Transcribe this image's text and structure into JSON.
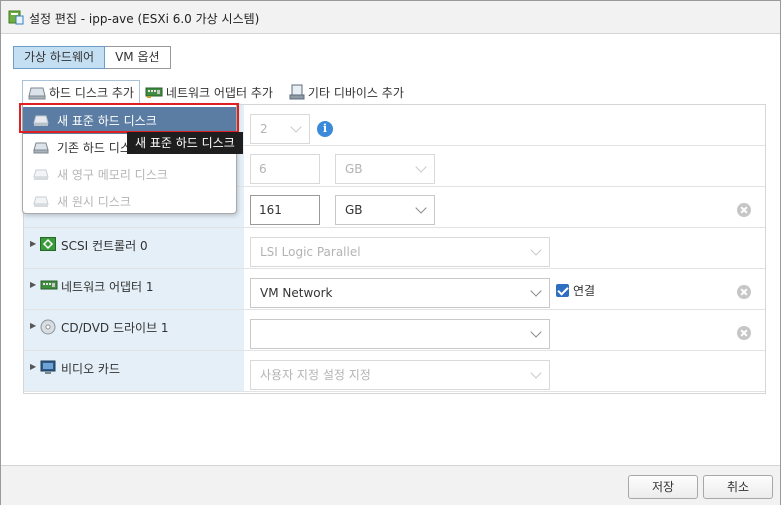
{
  "window": {
    "title": "설정 편집 - ipp-ave (ESXi 6.0 가상 시스템)"
  },
  "tabs": [
    {
      "label": "가상 하드웨어",
      "active": true
    },
    {
      "label": "VM 옵션",
      "active": false
    }
  ],
  "toolbar": {
    "add_disk": "하드 디스크 추가",
    "add_network": "네트워크 어댑터 추가",
    "add_other": "기타 디바이스 추가"
  },
  "dropdown_menu": {
    "items": [
      {
        "label": "새 표준 하드 디스크",
        "enabled": true,
        "highlighted": true
      },
      {
        "label": "기존 하드 디스크",
        "enabled": true,
        "highlighted": false
      },
      {
        "label": "새 영구 메모리 디스크",
        "enabled": false,
        "highlighted": false
      },
      {
        "label": "새 원시 디스크",
        "enabled": false,
        "highlighted": false
      }
    ],
    "tooltip": "새 표준 하드 디스크"
  },
  "hardware": {
    "cpu": {
      "value": "2"
    },
    "memory": {
      "value": "6",
      "unit": "GB"
    },
    "hard_disk": {
      "value": "161",
      "unit": "GB"
    },
    "scsi": {
      "label": "SCSI 컨트롤러 0",
      "value": "LSI Logic Parallel"
    },
    "network": {
      "label": "네트워크 어댑터 1",
      "value": "VM Network",
      "connected_label": "연결",
      "connected": true
    },
    "cdrom": {
      "label": "CD/DVD 드라이브 1",
      "value": ""
    },
    "video": {
      "label": "비디오 카드",
      "value": "사용자 지정 설정 지정"
    }
  },
  "footer": {
    "save": "저장",
    "cancel": "취소"
  },
  "colors": {
    "accent": "#c5dff2",
    "label_bg": "#e4eff8",
    "menu_highlight": "#5b7da3",
    "highlight_border": "#e02020",
    "info": "#3b8ad9"
  },
  "icons": {
    "title": "vm-settings-icon",
    "disk": "hard-disk-icon",
    "network": "network-card-icon",
    "device": "device-icon",
    "scsi": "scsi-controller-icon",
    "cdrom": "cd-dvd-icon",
    "video": "monitor-icon"
  }
}
